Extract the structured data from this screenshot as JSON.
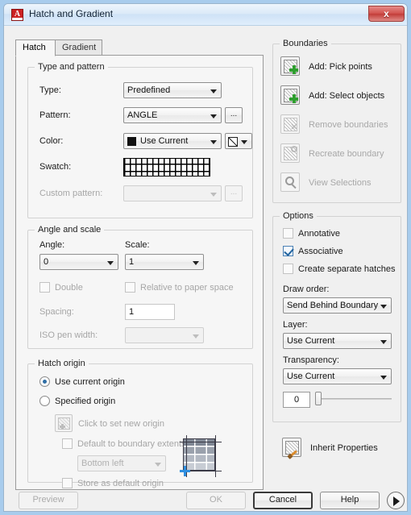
{
  "window": {
    "title": "Hatch and Gradient",
    "app_icon": "autocad-a-icon",
    "close_label": "x"
  },
  "tabs": [
    {
      "label": "Hatch",
      "active": true
    },
    {
      "label": "Gradient",
      "active": false
    }
  ],
  "type_and_pattern": {
    "legend": "Type and pattern",
    "type_label": "Type:",
    "type_value": "Predefined",
    "pattern_label": "Pattern:",
    "pattern_value": "ANGLE",
    "pattern_browse": "...",
    "color_label": "Color:",
    "color_value": "Use Current",
    "color_chip": "#111111",
    "swatch_label": "Swatch:",
    "swatch_pattern": "ANGLE",
    "custom_pattern_label": "Custom pattern:",
    "custom_pattern_value": "",
    "custom_pattern_browse": "..."
  },
  "angle_and_scale": {
    "legend": "Angle and scale",
    "angle_label": "Angle:",
    "angle_value": "0",
    "scale_label": "Scale:",
    "scale_value": "1",
    "double_label": "Double",
    "double_checked": false,
    "relative_label": "Relative to paper space",
    "relative_checked": false,
    "spacing_label": "Spacing:",
    "spacing_value": "1",
    "iso_pen_label": "ISO pen width:",
    "iso_pen_value": ""
  },
  "hatch_origin": {
    "legend": "Hatch origin",
    "use_current_label": "Use current origin",
    "use_current_selected": true,
    "specified_label": "Specified origin",
    "specified_selected": false,
    "click_set_label": "Click to set new origin",
    "default_extents_label": "Default to boundary extents",
    "default_extents_checked": false,
    "corner_value": "Bottom left",
    "store_default_label": "Store as default origin",
    "store_default_checked": false,
    "preview_name": "brick-origin-preview"
  },
  "boundaries": {
    "legend": "Boundaries",
    "items": [
      {
        "label": "Add: Pick points",
        "icon": "pick-points-icon",
        "enabled": true
      },
      {
        "label": "Add: Select objects",
        "icon": "select-objects-icon",
        "enabled": true
      },
      {
        "label": "Remove boundaries",
        "icon": "remove-boundaries-icon",
        "enabled": false
      },
      {
        "label": "Recreate boundary",
        "icon": "recreate-boundary-icon",
        "enabled": false
      },
      {
        "label": "View Selections",
        "icon": "view-selections-icon",
        "enabled": false
      }
    ]
  },
  "options": {
    "legend": "Options",
    "annotative_label": "Annotative",
    "annotative_checked": false,
    "associative_label": "Associative",
    "associative_checked": true,
    "separate_label": "Create separate hatches",
    "separate_checked": false,
    "draw_order_label": "Draw order:",
    "draw_order_value": "Send Behind Boundary",
    "layer_label": "Layer:",
    "layer_value": "Use Current",
    "transparency_label": "Transparency:",
    "transparency_value": "Use Current",
    "transparency_amount": "0"
  },
  "inherit": {
    "label": "Inherit Properties",
    "icon": "inherit-properties-icon"
  },
  "footer": {
    "preview_label": "Preview",
    "preview_enabled": false,
    "ok_label": "OK",
    "ok_enabled": false,
    "cancel_label": "Cancel",
    "help_label": "Help",
    "expand_icon": "expand-more-arrow-icon"
  }
}
